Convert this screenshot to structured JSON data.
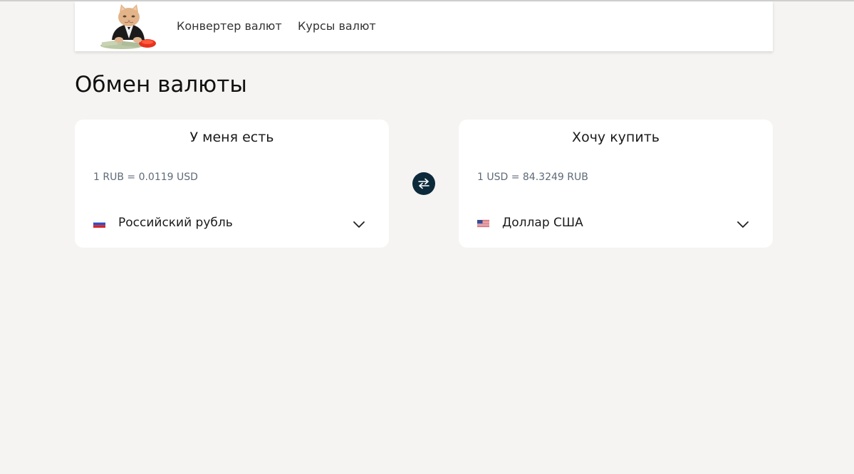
{
  "nav": {
    "converter_label": "Конвертер валют",
    "rates_label": "Курсы валют"
  },
  "page": {
    "title": "Обмен валюты"
  },
  "have_card": {
    "title": "У меня есть",
    "rate": "1 RUB = 0.0119 USD",
    "selected_currency": "Российский рубль",
    "flag": "russia-flag-icon"
  },
  "want_card": {
    "title": "Хочу купить",
    "rate": "1 USD = 84.3249 RUB",
    "selected_currency": "Доллар США",
    "flag": "usa-flag-icon"
  },
  "colors": {
    "background": "#f5f4f2",
    "card": "#ffffff",
    "swap_button": "#0c2a3a",
    "rate_text": "#5e6a78"
  }
}
